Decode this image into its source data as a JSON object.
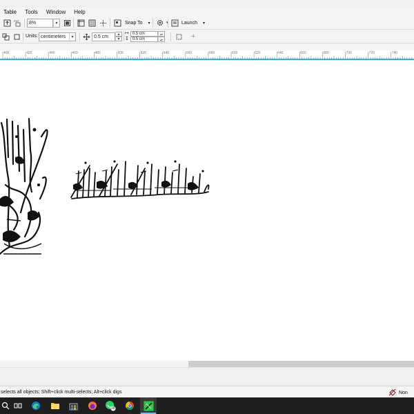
{
  "menu": {
    "items": [
      {
        "label": "Table",
        "name": "menu-table"
      },
      {
        "label": "Tools",
        "name": "menu-tools"
      },
      {
        "label": "Window",
        "name": "menu-window"
      },
      {
        "label": "Help",
        "name": "menu-help"
      }
    ]
  },
  "toolbar": {
    "zoom_value": "8%",
    "snap_label": "Snap To",
    "launch_label": "Launch",
    "units_label": "Units:",
    "units_value": "centimeters",
    "nudge_value": "0.5 cm",
    "dup_x": "0.5 cm",
    "dup_y": "0.5 cm",
    "plus": "+"
  },
  "ruler": {
    "labels": [
      "400",
      "420",
      "440",
      "460",
      "480",
      "500",
      "520",
      "540",
      "560",
      "580",
      "600",
      "620",
      "640",
      "660",
      "680",
      "700",
      "720",
      "740"
    ]
  },
  "status": {
    "hint": "selects all objects; Shift+click multi-selects; Alt+click digs",
    "fill_label": "Non"
  },
  "taskbar": {
    "badge": "18"
  },
  "colors": {
    "ruler_accent": "#00a6d6",
    "calligraphy": "#111111"
  }
}
